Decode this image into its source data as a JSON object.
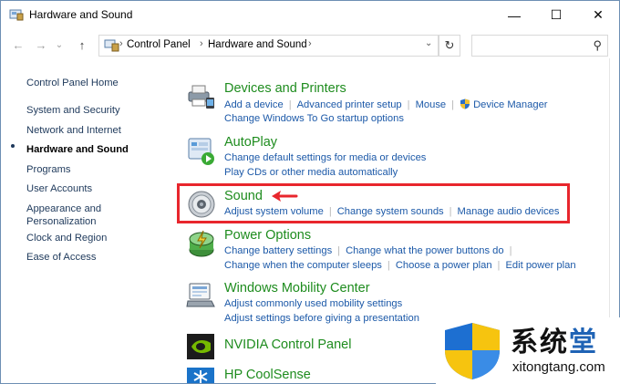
{
  "window": {
    "title": "Hardware and Sound",
    "buttons": [
      "—",
      "☐",
      "✕"
    ]
  },
  "nav": {
    "back": "←",
    "forward": "→",
    "recent": "⌄",
    "up": "↑",
    "breadcrumbs": [
      "Control Panel",
      "Hardware and Sound"
    ],
    "refresh": "↻",
    "search_placeholder": ""
  },
  "sidebar": {
    "items": [
      {
        "label": "Control Panel Home"
      },
      {
        "label": "System and Security"
      },
      {
        "label": "Network and Internet"
      },
      {
        "label": "Hardware and Sound",
        "active": true
      },
      {
        "label": "Programs"
      },
      {
        "label": "User Accounts"
      },
      {
        "label": "Appearance and"
      },
      {
        "label": "Personalization"
      },
      {
        "label": "Clock and Region"
      },
      {
        "label": "Ease of Access"
      }
    ]
  },
  "categories": {
    "devices": {
      "title": "Devices and Printers",
      "row1": [
        "Add a device",
        "Advanced printer setup",
        "Mouse",
        "Device Manager"
      ],
      "row2": [
        "Change Windows To Go startup options"
      ]
    },
    "autoplay": {
      "title": "AutoPlay",
      "row1": [
        "Change default settings for media or devices"
      ],
      "row2": [
        "Play CDs or other media automatically"
      ]
    },
    "sound": {
      "title": "Sound",
      "row1": [
        "Adjust system volume",
        "Change system sounds",
        "Manage audio devices"
      ]
    },
    "power": {
      "title": "Power Options",
      "row1": [
        "Change battery settings",
        "Change what the power buttons do"
      ],
      "row2": [
        "Change when the computer sleeps",
        "Choose a power plan",
        "Edit power plan"
      ]
    },
    "mobility": {
      "title": "Windows Mobility Center",
      "row1": [
        "Adjust commonly used mobility settings"
      ],
      "row2": [
        "Adjust settings before giving a presentation"
      ]
    },
    "nvidia": {
      "title": "NVIDIA Control Panel"
    },
    "hp": {
      "title": "HP CoolSense"
    }
  },
  "watermark": {
    "chinese": "系统",
    "chinese_last": "堂",
    "url": "xitongtang.com"
  },
  "colors": {
    "category_title": "#1e8c1e",
    "link": "#1c59a8",
    "highlight_box": "#e8262d",
    "sidebar_link": "#1e395b"
  }
}
